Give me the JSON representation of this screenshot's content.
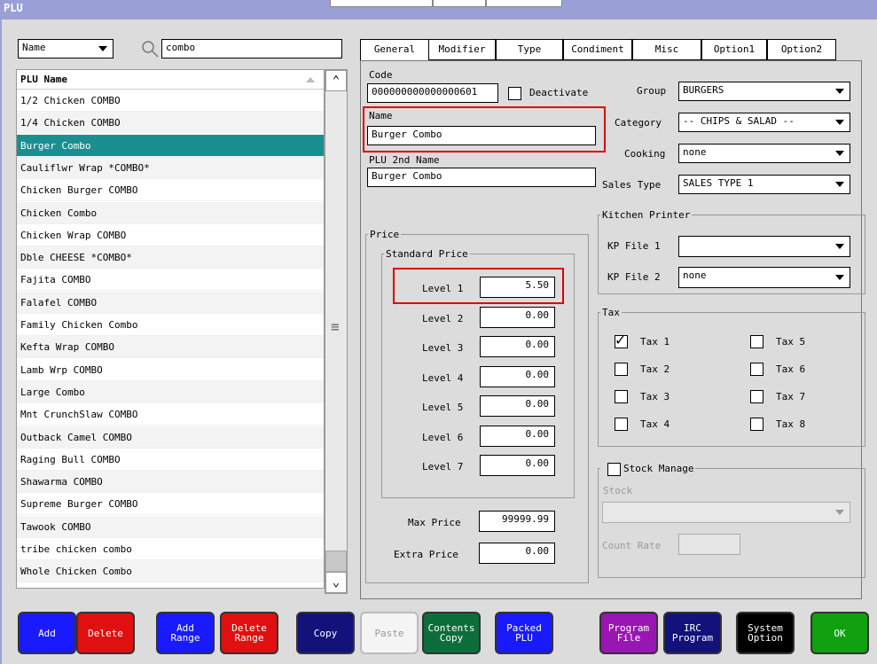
{
  "window": {
    "title": "PLU"
  },
  "search": {
    "field": "Name",
    "query": "combo"
  },
  "list": {
    "header": "PLU Name",
    "items": [
      "1/2 Chicken COMBO",
      "1/4 Chicken COMBO",
      "Burger Combo",
      "Cauliflwr Wrap *COMBO*",
      "Chicken Burger COMBO",
      "Chicken Combo",
      "Chicken Wrap COMBO",
      "Dble CHEESE *COMBO*",
      "Fajita COMBO",
      "Falafel COMBO",
      "Family Chicken Combo",
      "Kefta Wrap COMBO",
      "Lamb Wrp COMBO",
      "Large Combo",
      "Mnt CrunchSlaw COMBO",
      "Outback Camel COMBO",
      "Raging Bull COMBO",
      "Shawarma COMBO",
      "Supreme Burger COMBO",
      "Tawook COMBO",
      "tribe chicken combo",
      "Whole Chicken Combo"
    ]
  },
  "tabs": [
    "General",
    "Modifier",
    "Type",
    "Condiment",
    "Misc",
    "Option1",
    "Option2"
  ],
  "general": {
    "code_label": "Code",
    "code_value": "000000000000000601",
    "deactivate_label": "Deactivate",
    "name_label": "Name",
    "name_value": "Burger Combo",
    "name2_label": "PLU 2nd Name",
    "name2_value": "Burger Combo",
    "group_label": "Group",
    "group_value": "BURGERS",
    "category_label": "Category",
    "category_value": "-- CHIPS & SALAD --",
    "cooking_label": "Cooking",
    "cooking_value": "none",
    "salestype_label": "Sales Type",
    "salestype_value": "SALES TYPE 1"
  },
  "price": {
    "legend": "Price",
    "standard_legend": "Standard Price",
    "levels": [
      {
        "label": "Level 1",
        "value": "5.50"
      },
      {
        "label": "Level 2",
        "value": "0.00"
      },
      {
        "label": "Level 3",
        "value": "0.00"
      },
      {
        "label": "Level 4",
        "value": "0.00"
      },
      {
        "label": "Level 5",
        "value": "0.00"
      },
      {
        "label": "Level 6",
        "value": "0.00"
      },
      {
        "label": "Level 7",
        "value": "0.00"
      }
    ],
    "max_label": "Max Price",
    "max_value": "99999.99",
    "extra_label": "Extra Price",
    "extra_value": "0.00"
  },
  "kitchen": {
    "legend": "Kitchen Printer",
    "kp1_label": "KP File 1",
    "kp1_value": "",
    "kp2_label": "KP File 2",
    "kp2_value": "none"
  },
  "tax": {
    "legend": "Tax",
    "items": [
      {
        "label": "Tax 1",
        "checked": true
      },
      {
        "label": "Tax 2",
        "checked": false
      },
      {
        "label": "Tax 3",
        "checked": false
      },
      {
        "label": "Tax 4",
        "checked": false
      },
      {
        "label": "Tax 5",
        "checked": false
      },
      {
        "label": "Tax 6",
        "checked": false
      },
      {
        "label": "Tax 7",
        "checked": false
      },
      {
        "label": "Tax 8",
        "checked": false
      }
    ]
  },
  "stock": {
    "legend": "Stock Manage",
    "stock_label": "Stock",
    "count_rate_label": "Count Rate"
  },
  "buttons": [
    {
      "label": "Add",
      "color": "#1a1aff"
    },
    {
      "label": "Delete",
      "color": "#e01010"
    },
    {
      "label": "Add\nRange",
      "color": "#1a1aff"
    },
    {
      "label": "Delete\nRange",
      "color": "#e01010"
    },
    {
      "label": "Copy",
      "color": "#12127a"
    },
    {
      "label": "Paste",
      "color": "#f4f4f4"
    },
    {
      "label": "Contents\nCopy",
      "color": "#0c6e3a"
    },
    {
      "label": "Packed\nPLU",
      "color": "#1a1aff"
    },
    {
      "label": "Program\nFile",
      "color": "#9a16b4"
    },
    {
      "label": "IRC\nProgram",
      "color": "#12127a"
    },
    {
      "label": "System\nOption",
      "color": "#000000"
    },
    {
      "label": "OK",
      "color": "#10a010"
    }
  ]
}
